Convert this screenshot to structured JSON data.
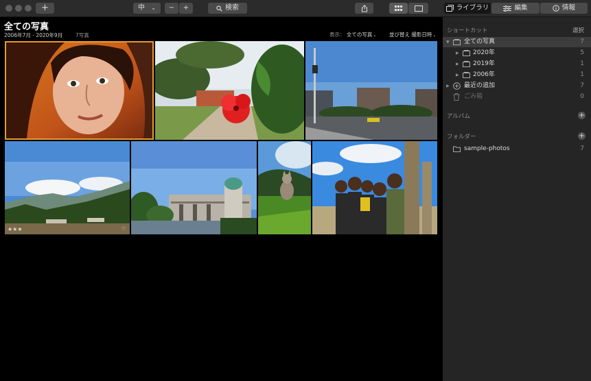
{
  "toolbar": {
    "add_label": "+",
    "size_label": "中",
    "size_chevron": "⌄",
    "zoom_out": "−",
    "zoom_in": "+",
    "search_label": "検索",
    "tabs": {
      "library": "ライブラリ",
      "edit": "編集",
      "info": "情報"
    }
  },
  "main": {
    "title": "全ての写真",
    "date_range": "2006年7月 - 2020年9月",
    "count": "7写真",
    "view_label": "表示：",
    "view_value": "全ての写真",
    "sort_label": "並び替え",
    "sort_value": "撮影日時"
  },
  "sidebar": {
    "shortcuts_header": "ショートカット",
    "select_label": "選択",
    "items": [
      {
        "label": "全ての写真",
        "count": "7"
      },
      {
        "label": "2020年",
        "count": "5"
      },
      {
        "label": "2019年",
        "count": "1"
      },
      {
        "label": "2006年",
        "count": "1"
      },
      {
        "label": "最近の追加",
        "count": "7"
      },
      {
        "label": "ごみ箱",
        "count": "0"
      }
    ],
    "albums_header": "アルバム",
    "folders_header": "フォルダー",
    "folders": [
      {
        "label": "sample-photos",
        "count": "7"
      }
    ]
  },
  "colors": {
    "selection": "#e89a2c",
    "accent_bg": "#252525"
  }
}
